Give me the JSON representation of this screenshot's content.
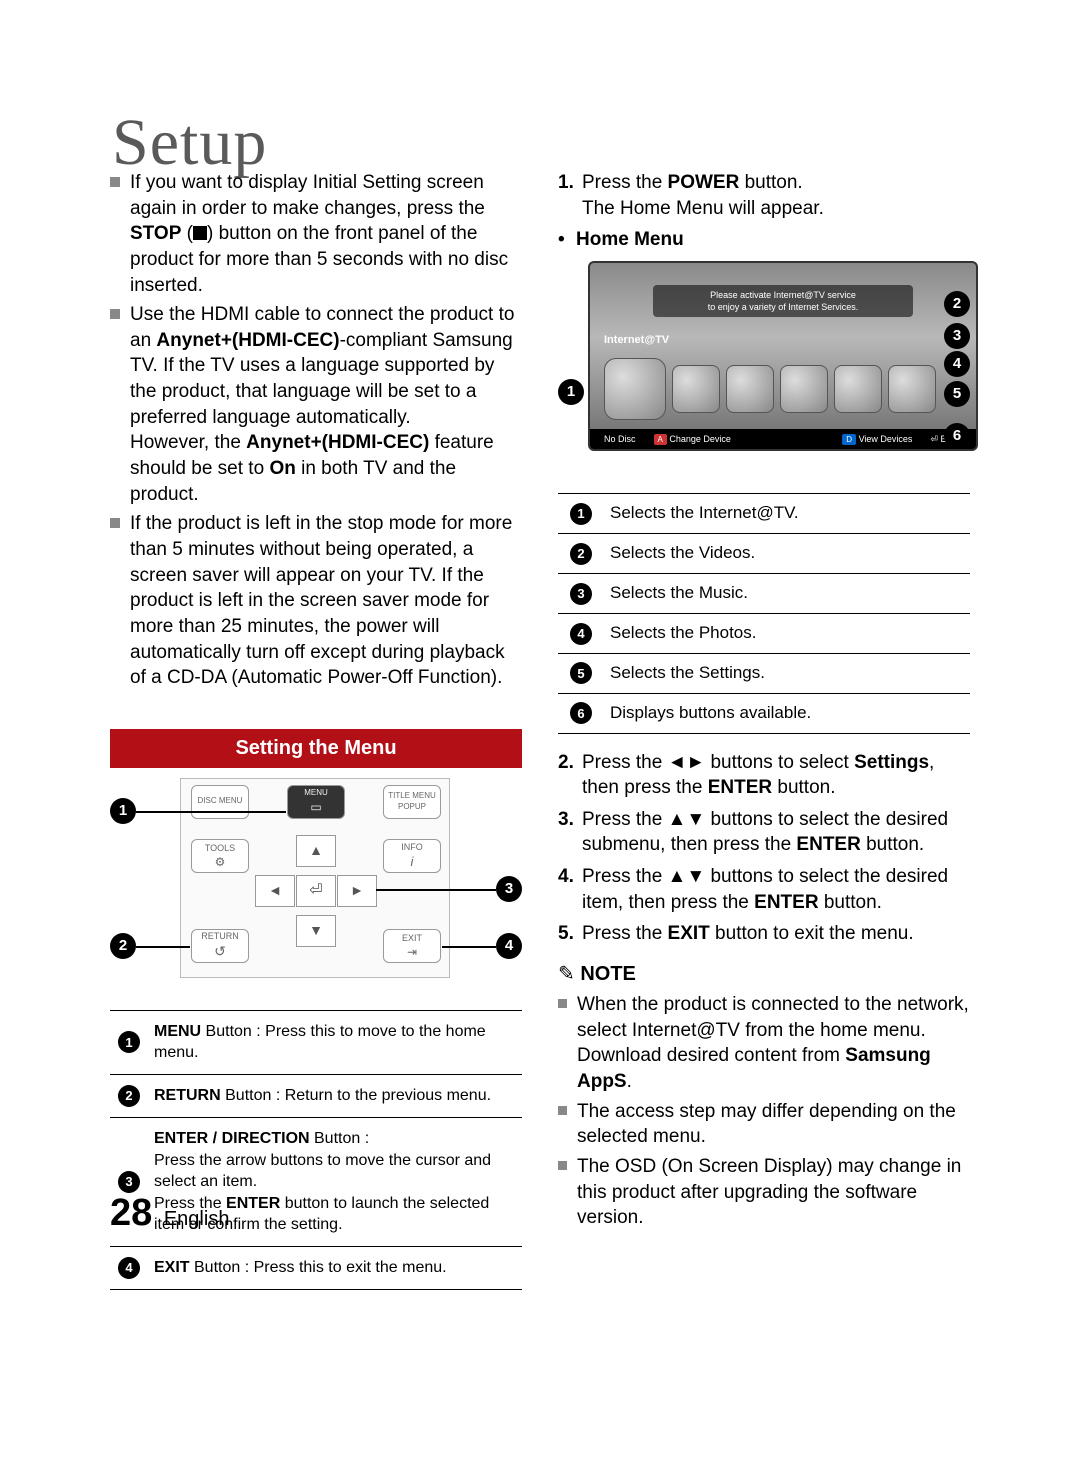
{
  "title": "Setup",
  "leftBullets": [
    {
      "pre": "If you want to display Initial Setting screen again in order to make changes, press the ",
      "b1": "STOP",
      "mid1": " (",
      "icon": "stop",
      "mid2": ") button on the front panel of the product for more than 5 seconds with no disc inserted."
    },
    {
      "pre": "Use the HDMI cable to connect the product to an ",
      "b1": "Anynet+(HDMI-CEC)",
      "mid1": "-compliant Samsung TV. If the TV uses a language supported by the product, that language will be set to a preferred language automatically.\nHowever, the ",
      "b2": "Anynet+(HDMI-CEC)",
      "mid2": " feature should be set to ",
      "b3": "On",
      "post": " in both TV and the product."
    },
    {
      "pre": "If the product is left in the stop mode for more than 5 minutes without being operated, a screen saver will appear on your TV. If the product is left in the screen saver mode for more than 25 minutes, the power will automatically turn off except during playback of a CD-DA (Automatic Power-Off Function)."
    }
  ],
  "sectionBar": "Setting the Menu",
  "remoteKeys": {
    "discMenu": "DISC MENU",
    "menu": "MENU",
    "titleMenu": "TITLE MENU",
    "popup": "POPUP",
    "tools": "TOOLS",
    "info": "INFO",
    "return": "RETURN",
    "exit": "EXIT"
  },
  "remoteDesc": [
    {
      "n": "1",
      "html": "<span class='bold'>MENU</span> Button : Press this to move to the home menu."
    },
    {
      "n": "2",
      "html": "<span class='bold'>RETURN</span> Button : Return to the previous menu."
    },
    {
      "n": "3",
      "html": "<span class='bold'>ENTER / DIRECTION</span> Button :<br>Press the arrow buttons to move the cursor and select an item.<br>Press the <span class='bold'>ENTER</span> button to launch the selected item or confirm the setting."
    },
    {
      "n": "4",
      "html": "<span class='bold'>EXIT</span> Button : Press this to exit the menu."
    }
  ],
  "step1": {
    "num": "1.",
    "pre": "Press the ",
    "b": "POWER",
    "post": " button.\nThe Home Menu will appear."
  },
  "homeMenuLabel": "Home Menu",
  "tvBanner": "Please activate Internet@TV service\nto enjoy a variety of Internet Services.",
  "tvLabel": "Internet@TV",
  "tvBottom": {
    "nodisc": "No Disc",
    "a": "A",
    "change": "Change Device",
    "d": "D",
    "view": "View Devices",
    "enterIcon": "⏎",
    "enter": "Enter"
  },
  "tvDesc": [
    {
      "n": "1",
      "t": "Selects the Internet@TV."
    },
    {
      "n": "2",
      "t": "Selects the Videos."
    },
    {
      "n": "3",
      "t": "Selects the Music."
    },
    {
      "n": "4",
      "t": "Selects the Photos."
    },
    {
      "n": "5",
      "t": "Selects the Settings."
    },
    {
      "n": "6",
      "t": "Displays buttons available."
    }
  ],
  "steps2": [
    {
      "num": "2.",
      "pre": "Press the ",
      "ar": "◄►",
      "mid": " buttons to select ",
      "b": "Settings",
      "post": ", then press the ",
      "b2": "ENTER",
      "end": " button."
    },
    {
      "num": "3.",
      "pre": "Press the ",
      "ar": "▲▼",
      "mid": " buttons to select the desired submenu, then press the ",
      "b": "ENTER",
      "end": " button."
    },
    {
      "num": "4.",
      "pre": "Press the ",
      "ar": "▲▼",
      "mid": " buttons to select the desired item, then press the ",
      "b": "ENTER",
      "end": " button."
    },
    {
      "num": "5.",
      "pre": "Press the ",
      "b": "EXIT",
      "end": " button to exit the menu."
    }
  ],
  "noteHead": "NOTE",
  "notes": [
    {
      "pre": "When the product is connected to the network, select Internet@TV from the home menu. Download desired content from ",
      "b": "Samsung AppS",
      "post": "."
    },
    {
      "pre": "The access step may differ depending on the selected menu."
    },
    {
      "pre": "The OSD (On Screen Display) may change in this product after upgrading the software version."
    }
  ],
  "footer": {
    "page": "28",
    "lang": "English"
  }
}
